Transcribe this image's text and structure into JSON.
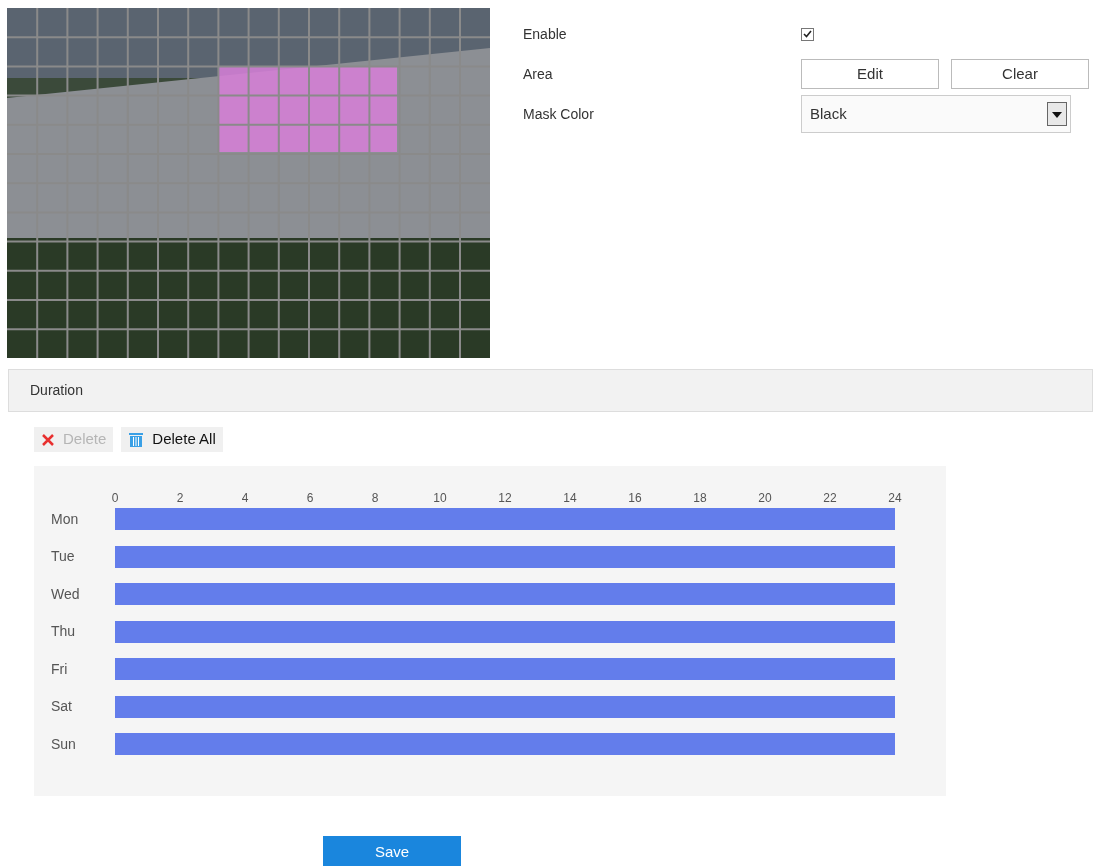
{
  "settings": {
    "enable": {
      "label": "Enable",
      "checked": true
    },
    "area": {
      "label": "Area",
      "buttons": [
        "Edit",
        "Clear"
      ]
    },
    "mask_color": {
      "label": "Mask Color",
      "value": "Black"
    }
  },
  "duration": {
    "title": "Duration",
    "toolbar": [
      {
        "label": "Delete",
        "kind": "delete",
        "disabled": true
      },
      {
        "label": "Delete All",
        "kind": "delete_all",
        "disabled": false
      }
    ],
    "ticks": [
      "0",
      "2",
      "4",
      "6",
      "8",
      "10",
      "12",
      "14",
      "16",
      "18",
      "20",
      "22",
      "24"
    ],
    "days": [
      {
        "label": "Mon",
        "level": 1
      },
      {
        "label": "Tue",
        "level": 1
      },
      {
        "label": "Wed",
        "level": 1
      },
      {
        "label": "Thu",
        "level": 1
      },
      {
        "label": "Fri",
        "level": 1
      },
      {
        "label": "Sat",
        "level": 1
      },
      {
        "label": "Sun",
        "level": 1
      }
    ]
  },
  "save": "Save"
}
